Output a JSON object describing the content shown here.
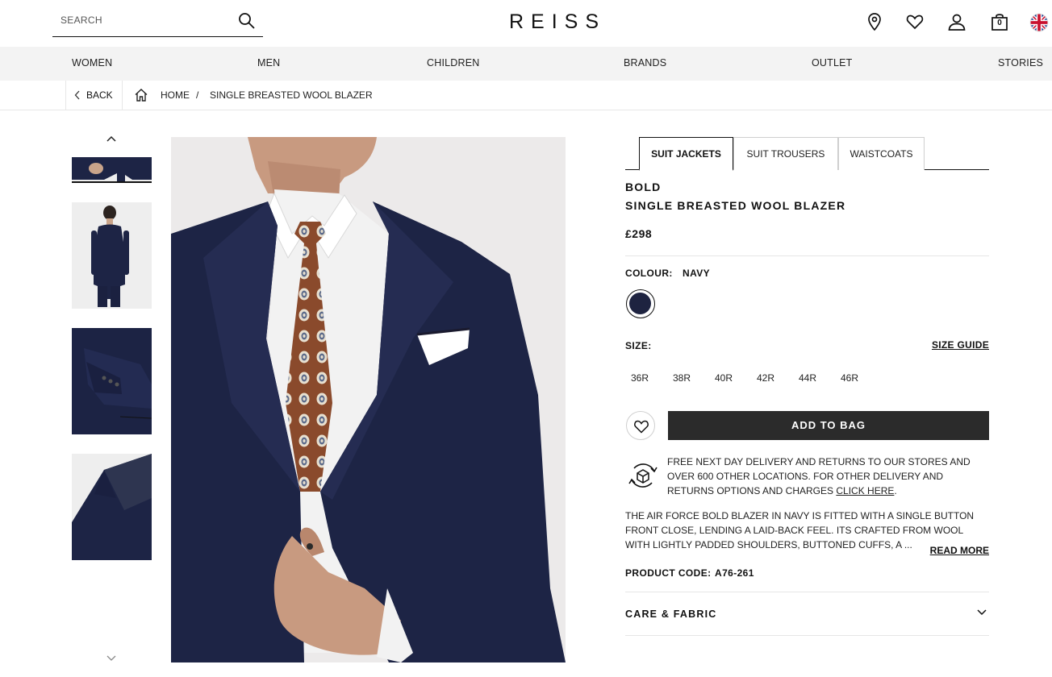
{
  "header": {
    "search_placeholder": "SEARCH",
    "logo": "REISS",
    "bag_count": "0"
  },
  "nav": {
    "items": [
      "WOMEN",
      "MEN",
      "CHILDREN",
      "BRANDS",
      "OUTLET",
      "STORIES"
    ]
  },
  "breadcrumb": {
    "back": "BACK",
    "home": "HOME",
    "separator": "/",
    "current": "SINGLE BREASTED WOOL BLAZER"
  },
  "product": {
    "tabs": [
      "SUIT JACKETS",
      "SUIT TROUSERS",
      "WAISTCOATS"
    ],
    "active_tab": "SUIT JACKETS",
    "brand": "BOLD",
    "name": "SINGLE BREASTED WOOL BLAZER",
    "price": "£298",
    "colour_label": "COLOUR:",
    "colour_value": "NAVY",
    "swatch_color": "#1e2340",
    "size_label": "SIZE:",
    "size_guide": "SIZE GUIDE",
    "sizes": [
      "36R",
      "38R",
      "40R",
      "42R",
      "44R",
      "46R"
    ],
    "add_to_bag": "ADD TO BAG",
    "delivery_text": "FREE NEXT DAY DELIVERY AND RETURNS TO OUR STORES AND OVER 600 OTHER LOCATIONS. FOR OTHER DELIVERY AND RETURNS OPTIONS AND CHARGES ",
    "delivery_link": "CLICK HERE",
    "delivery_end": ".",
    "description": "THE AIR FORCE BOLD BLAZER IN NAVY IS FITTED WITH A SINGLE BUTTON FRONT CLOSE, LENDING A LAID-BACK FEEL. ITS CRAFTED FROM WOOL WITH LIGHTLY PADDED SHOULDERS, BUTTONED CUFFS, A ...",
    "read_more": "READ MORE",
    "code_label": "PRODUCT CODE:",
    "code_value": "A76-261",
    "care_label": "CARE & FABRIC"
  },
  "colors": {
    "accent": "#2b2b2b",
    "nav_bg": "#f3f3f3",
    "navy": "#1e2340"
  }
}
